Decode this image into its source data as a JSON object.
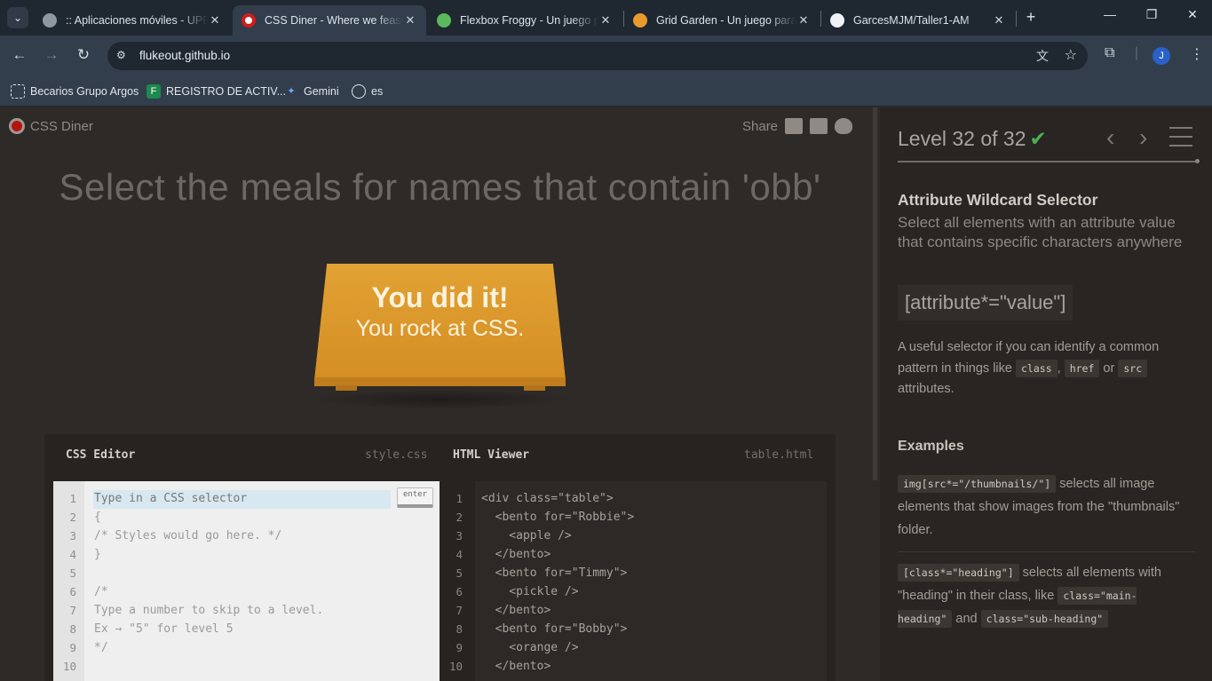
{
  "browser": {
    "tabs": [
      {
        "title": ":: Aplicaciones móviles - UPB",
        "icon": "globe-icon"
      },
      {
        "title": "CSS Diner - Where we feast on CSS",
        "icon": "cssdiner-icon"
      },
      {
        "title": "Flexbox Froggy - Un juego para aprender",
        "icon": "frog-icon"
      },
      {
        "title": "Grid Garden - Un juego para aprender",
        "icon": "carrot-icon"
      },
      {
        "title": "GarcesMJM/Taller1-AM",
        "icon": "github-icon"
      }
    ],
    "url": "flukeout.github.io",
    "avatar_letter": "J",
    "bookmarks": [
      {
        "label": "Becarios Grupo Argos",
        "icon": "bracket-icon"
      },
      {
        "label": "REGISTRO DE ACTIV...",
        "icon": "forms-icon"
      },
      {
        "label": "Gemini",
        "icon": "gemini-icon"
      },
      {
        "label": "es",
        "icon": "globe-icon"
      }
    ]
  },
  "game": {
    "logo": "CSS Diner",
    "share": "Share",
    "order": "Select the meals for names that contain 'obb'",
    "win_line1": "You did it!",
    "win_line2": "You rock at CSS.",
    "css_editor": {
      "title": "CSS Editor",
      "file": "style.css",
      "enter_label": "enter",
      "lines": [
        "Type in a CSS selector",
        "{",
        "/* Styles would go here. */",
        "}",
        "",
        "/*",
        "Type a number to skip to a level.",
        "Ex → \"5\" for level 5",
        "*/",
        ""
      ]
    },
    "html_viewer": {
      "title": "HTML Viewer",
      "file": "table.html",
      "lines": [
        "<div class=\"table\">",
        "  <bento for=\"Robbie\">",
        "    <apple />",
        "  </bento>",
        "  <bento for=\"Timmy\">",
        "    <pickle />",
        "  </bento>",
        "  <bento for=\"Bobby\">",
        "    <orange />",
        "  </bento>"
      ]
    }
  },
  "sidebar": {
    "level": "Level 32 of 32",
    "check": "✔",
    "selector_name": "Attribute Wildcard Selector",
    "description": "Select all elements with an attribute value that contains specific characters anywhere",
    "syntax": "[attribute*=\"value\"]",
    "hint_pre": "A useful selector if you can identify a common pattern in things like",
    "hint_code1": "class",
    "hint_comma": ",",
    "hint_code2": "href",
    "hint_or": "or",
    "hint_code3": "src",
    "hint_post": "attributes.",
    "examples_title": "Examples",
    "ex1_code": "img[src*=\"/thumbnails/\"]",
    "ex1_text": "selects all image elements that show images from the \"thumbnails\" folder.",
    "ex2_code": "[class*=\"heading\"]",
    "ex2_text": "selects all elements with \"heading\" in their class, like",
    "ex2_code2": "class=\"main-heading\"",
    "ex2_and": "and",
    "ex2_code3": "class=\"sub-heading\""
  }
}
